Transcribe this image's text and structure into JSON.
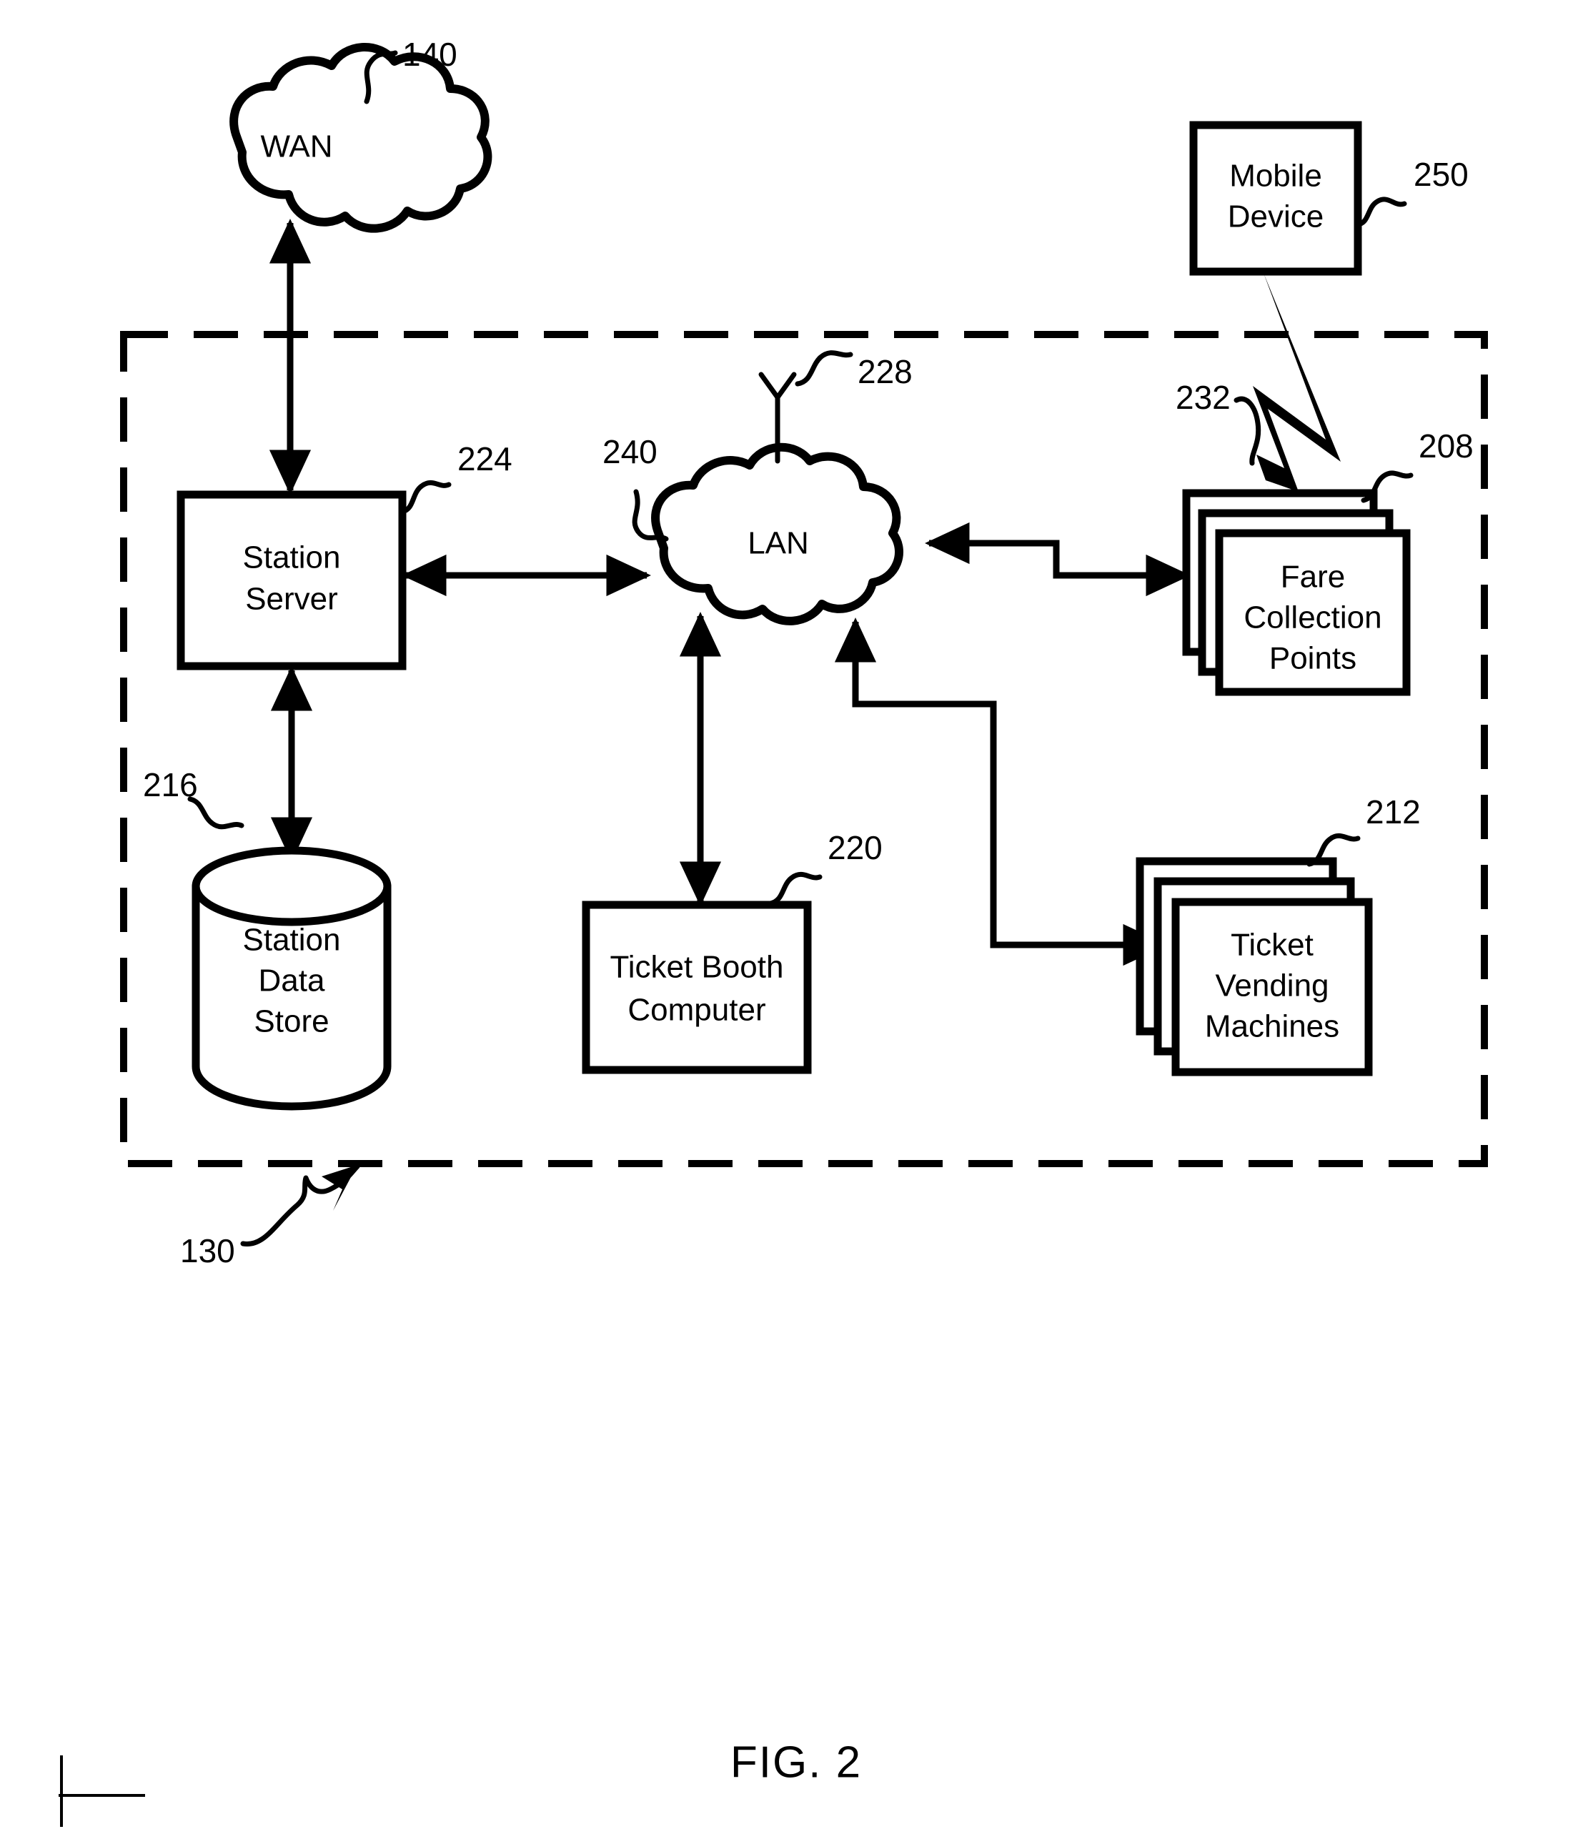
{
  "figure": {
    "caption": "FIG. 2"
  },
  "nodes": {
    "wan": {
      "label": "WAN",
      "ref": "140",
      "shape": "cloud"
    },
    "mobile_device": {
      "label_line1": "Mobile",
      "label_line2": "Device",
      "ref": "250",
      "shape": "box"
    },
    "station_server": {
      "label_line1": "Station",
      "label_line2": "Server",
      "ref": "224",
      "shape": "box"
    },
    "lan": {
      "label": "LAN",
      "ref": "240",
      "shape": "cloud"
    },
    "antenna": {
      "ref": "228",
      "icon": "antenna-icon"
    },
    "fare_collection_points": {
      "label_line1": "Fare",
      "label_line2": "Collection",
      "label_line3": "Points",
      "ref": "208",
      "shape": "stacked-box",
      "stack_count": 3
    },
    "wireless_link": {
      "ref": "232",
      "icon": "lightning-bolt-icon"
    },
    "station_data_store": {
      "label_line1": "Station",
      "label_line2": "Data",
      "label_line3": "Store",
      "ref": "216",
      "shape": "cylinder"
    },
    "ticket_booth_computer": {
      "label_line1": "Ticket Booth",
      "label_line2": "Computer",
      "ref": "220",
      "shape": "box"
    },
    "ticket_vending_machines": {
      "label_line1": "Ticket",
      "label_line2": "Vending",
      "label_line3": "Machines",
      "ref": "212",
      "shape": "stacked-box",
      "stack_count": 3
    },
    "station_boundary": {
      "ref": "130",
      "shape": "dashed-rectangle"
    }
  },
  "colors": {
    "ink": "#000000",
    "paper": "#ffffff"
  }
}
